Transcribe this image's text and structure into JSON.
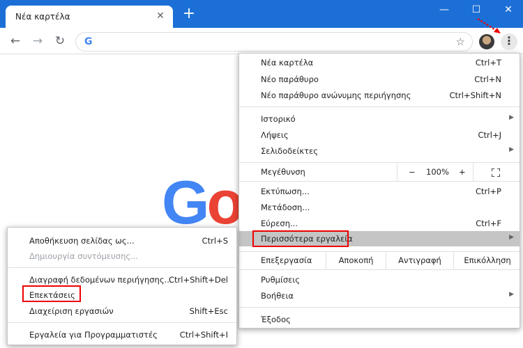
{
  "tab": {
    "title": "Νέα καρτέλα",
    "close": "✕"
  },
  "window": {
    "new_tab": "+",
    "minimize": "—",
    "maximize": "☐",
    "close": "✕"
  },
  "nav": {
    "back": "←",
    "forward": "→",
    "reload": "↻",
    "google_g": "G",
    "star": "☆",
    "kebab": "⋮"
  },
  "logo": {
    "g": "G",
    "o": "o"
  },
  "main_menu": {
    "new_tab": {
      "label": "Νέα καρτέλα",
      "shortcut": "Ctrl+T"
    },
    "new_window": {
      "label": "Νέο παράθυρο",
      "shortcut": "Ctrl+N"
    },
    "incognito": {
      "label": "Νέο παράθυρο ανώνυμης περιήγησης",
      "shortcut": "Ctrl+Shift+N"
    },
    "history": {
      "label": "Ιστορικό"
    },
    "downloads": {
      "label": "Λήψεις",
      "shortcut": "Ctrl+J"
    },
    "bookmarks": {
      "label": "Σελιδοδείκτες"
    },
    "zoom": {
      "label": "Μεγέθυνση",
      "minus": "−",
      "value": "100%",
      "plus": "+"
    },
    "print": {
      "label": "Εκτύπωση...",
      "shortcut": "Ctrl+P"
    },
    "cast": {
      "label": "Μετάδοση..."
    },
    "find": {
      "label": "Εύρεση...",
      "shortcut": "Ctrl+F"
    },
    "more_tools": {
      "label": "Περισσότερα εργαλεία"
    },
    "edit": {
      "label": "Επεξεργασία",
      "cut": "Αποκοπή",
      "copy": "Αντιγραφή",
      "paste": "Επικόλληση"
    },
    "settings": {
      "label": "Ρυθμίσεις"
    },
    "help": {
      "label": "Βοήθεια"
    },
    "exit": {
      "label": "Έξοδος"
    },
    "arrow": "▶"
  },
  "sub_menu": {
    "save_page": {
      "label": "Αποθήκευση σελίδας ως...",
      "shortcut": "Ctrl+S"
    },
    "create_shortcut": {
      "label": "Δημιουργία συντόμευσης..."
    },
    "clear_data": {
      "label": "Διαγραφή δεδομένων περιήγησης...",
      "shortcut": "Ctrl+Shift+Del"
    },
    "extensions": {
      "label": "Επεκτάσεις"
    },
    "task_manager": {
      "label": "Διαχείριση εργασιών",
      "shortcut": "Shift+Esc"
    },
    "dev_tools": {
      "label": "Εργαλεία για Προγραμματιστές",
      "shortcut": "Ctrl+Shift+I"
    }
  },
  "colors": {
    "titlebar": "#1c6fd6",
    "highlight": "#c5c5c5",
    "annotation": "#ee0000"
  }
}
